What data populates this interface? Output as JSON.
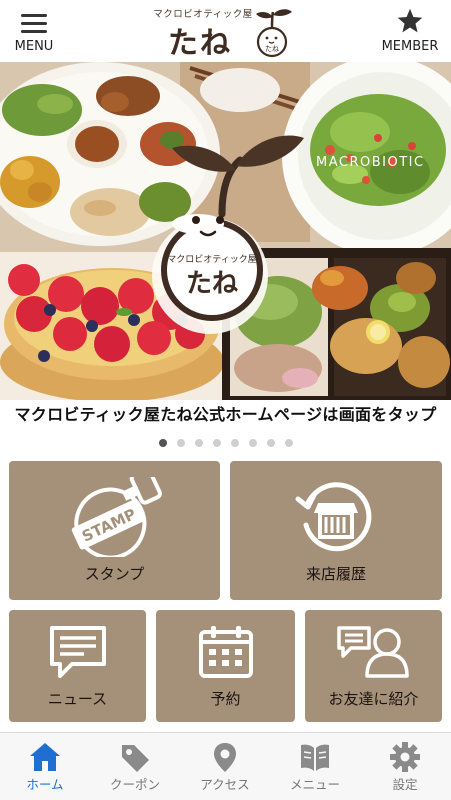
{
  "header": {
    "menu_label": "MENU",
    "member_label": "MEMBER",
    "logo_sub": "マクロビオティック屋",
    "logo_main": "たね",
    "mascot_text": "たね"
  },
  "hero": {
    "overlay_text": "MACROBIOTIC",
    "mascot_sub": "マクロビオティック屋",
    "mascot_main": "たね",
    "caption": "マクロビティック屋たね公式ホームページは画面をタップ",
    "slide_count": 8,
    "active_slide": 1
  },
  "stamp_text": "STAMP",
  "tiles": [
    {
      "label": "スタンプ",
      "icon": "stamp-icon"
    },
    {
      "label": "来店履歴",
      "icon": "shop-history-icon"
    },
    {
      "label": "ニュース",
      "icon": "news-icon"
    },
    {
      "label": "予約",
      "icon": "calendar-icon"
    },
    {
      "label": "お友達に紹介",
      "icon": "friend-icon"
    }
  ],
  "nav": [
    {
      "label": "ホーム",
      "icon": "home-icon",
      "active": true
    },
    {
      "label": "クーポン",
      "icon": "coupon-icon",
      "active": false
    },
    {
      "label": "アクセス",
      "icon": "map-pin-icon",
      "active": false
    },
    {
      "label": "メニュー",
      "icon": "book-icon",
      "active": false
    },
    {
      "label": "設定",
      "icon": "gear-icon",
      "active": false
    }
  ],
  "colors": {
    "tile_bg": "#a5917a",
    "nav_active": "#1f6fd1",
    "nav_inactive": "#8a8a8a",
    "logo_brown": "#3e2c22"
  }
}
